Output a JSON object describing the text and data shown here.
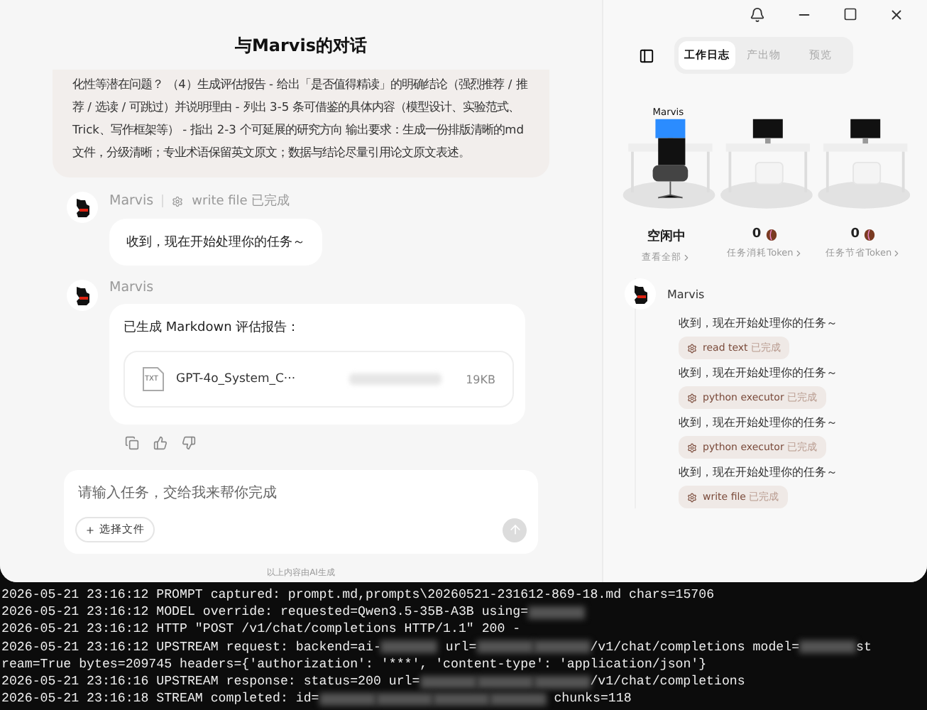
{
  "chat": {
    "title": "与Marvis的对话",
    "prompt": "化性等潜在问题？ （4）生成评估报告 - 给出「是否值得精读」的明确结论（强烈推荐 / 推荐 / 选读 / 可跳过）并说明理由 - 列出 3-5 条可借鉴的具体内容（模型设计、实验范式、Trick、写作框架等） - 指出 2-3 个可延展的研究方向 输出要求：生成一份排版清晰的md文件，分级清晰；专业术语保留英文原文；数据与结论尽量引用论文原文表述。",
    "messages": [
      {
        "kind": "text",
        "sender": "Marvis",
        "tool": "write file",
        "tool_status": "已完成",
        "text": "收到，现在开始处理你的任务～"
      },
      {
        "kind": "file",
        "sender": "Marvis",
        "text": "已生成 Markdown 评估报告：",
        "file": {
          "type": "TXT",
          "name": "GPT-4o_System_C···",
          "size": "19KB"
        }
      }
    ],
    "input": {
      "placeholder": "请输入任务，交给我来帮你完成",
      "attach": "选择文件"
    },
    "footer": "以上内容由AI生成"
  },
  "panel": {
    "tabs": [
      {
        "label": "工作日志",
        "selected": true
      },
      {
        "label": "产出物",
        "selected": false
      },
      {
        "label": "预览",
        "selected": false
      }
    ],
    "office": {
      "agent": "Marvis"
    },
    "stats": [
      {
        "value": "空闲中",
        "label": "查看全部",
        "kind": "status"
      },
      {
        "value": "0",
        "label": "任务消耗Token",
        "kind": "coffee"
      },
      {
        "value": "0",
        "label": "任务节省Token",
        "kind": "coffee"
      }
    ],
    "log": {
      "sender": "Marvis",
      "entries": [
        {
          "text": "收到，现在开始处理你的任务～",
          "tool": "read text",
          "status": "已完成"
        },
        {
          "text": "收到，现在开始处理你的任务～",
          "tool": "python executor",
          "status": "已完成"
        },
        {
          "text": "收到，现在开始处理你的任务～",
          "tool": "python executor",
          "status": "已完成"
        },
        {
          "text": "收到，现在开始处理你的任务～",
          "tool": "write file",
          "status": "已完成"
        }
      ]
    }
  },
  "terminal": {
    "lines": [
      [
        {
          "kind": "text",
          "text": "2026-05-21 23:16:12 PROMPT captured: prompt.md,prompts\\20260521-231612-869-18.md chars=15706"
        }
      ],
      [
        {
          "kind": "text",
          "text": "2026-05-21 23:16:12 MODEL override: requested=Qwen3.5-35B-A3B using="
        },
        {
          "kind": "blur"
        }
      ],
      [
        {
          "kind": "text",
          "text": "2026-05-21 23:16:12 HTTP \"POST /v1/chat/completions HTTP/1.1\" 200 -"
        }
      ],
      [
        {
          "kind": "text",
          "text": "2026-05-21 23:16:12 UPSTREAM request: backend=ai-"
        },
        {
          "kind": "blur"
        },
        {
          "kind": "text",
          "text": " url="
        },
        {
          "kind": "blur"
        },
        {
          "kind": "blur"
        },
        {
          "kind": "text",
          "text": "/v1/chat/completions model="
        },
        {
          "kind": "blur"
        },
        {
          "kind": "text",
          "text": "st"
        }
      ],
      [
        {
          "kind": "text",
          "text": "ream=True bytes=209745 headers={'authorization': '***', 'content-type': 'application/json'}"
        }
      ],
      [
        {
          "kind": "text",
          "text": "2026-05-21 23:16:16 UPSTREAM response: status=200 url="
        },
        {
          "kind": "blur"
        },
        {
          "kind": "blur"
        },
        {
          "kind": "blur"
        },
        {
          "kind": "text",
          "text": "/v1/chat/completions"
        }
      ],
      [
        {
          "kind": "text",
          "text": "2026-05-21 23:16:18 STREAM completed: id="
        },
        {
          "kind": "blur"
        },
        {
          "kind": "blur"
        },
        {
          "kind": "blur"
        },
        {
          "kind": "blur"
        },
        {
          "kind": "text",
          "text": " chunks=118"
        }
      ]
    ]
  }
}
